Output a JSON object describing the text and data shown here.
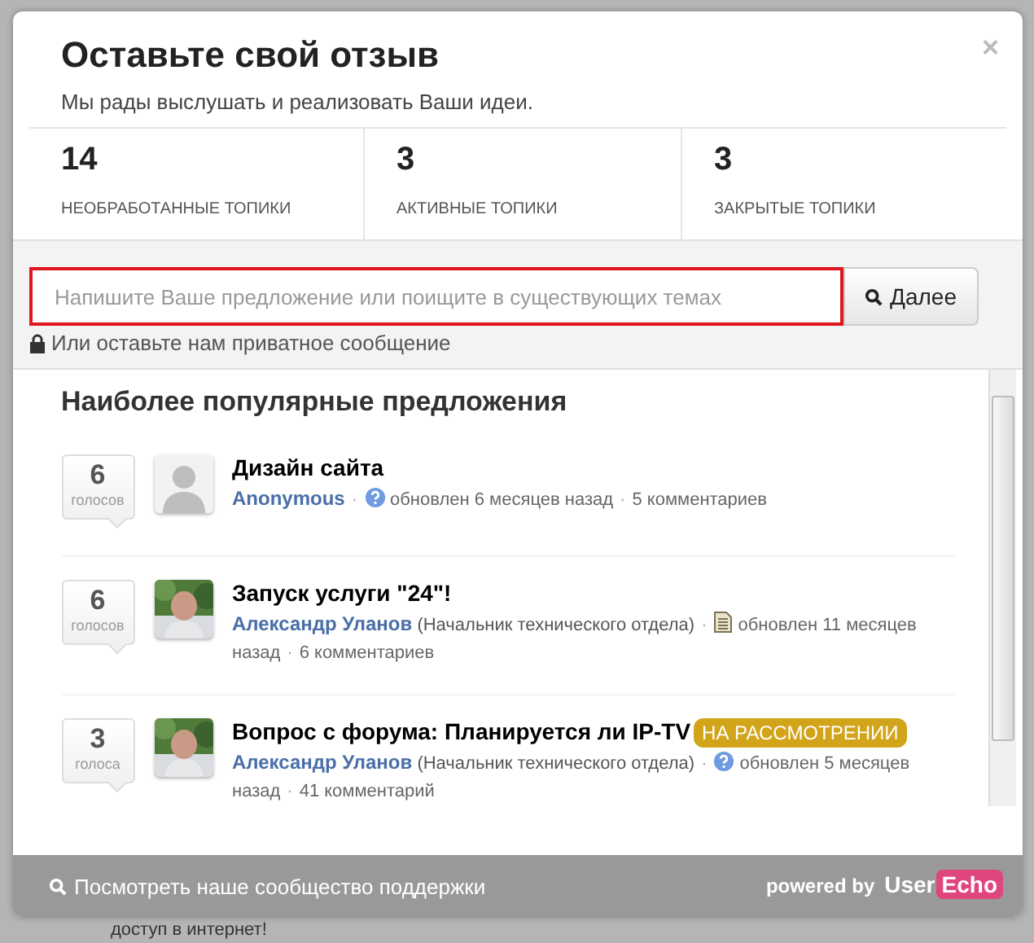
{
  "header": {
    "title": "Оставьте свой отзыв",
    "subtitle": "Мы рады выслушать и реализовать Ваши идеи.",
    "close": "×"
  },
  "stats": [
    {
      "count": "14",
      "label": "НЕОБРАБОТАННЫЕ ТОПИКИ"
    },
    {
      "count": "3",
      "label": "АКТИВНЫЕ ТОПИКИ"
    },
    {
      "count": "3",
      "label": "ЗАКРЫТЫЕ ТОПИКИ"
    }
  ],
  "search": {
    "placeholder": "Напишите Ваше предложение или поищите в существующих темах",
    "button": "Далее",
    "private_link": "Или оставьте нам приватное сообщение"
  },
  "list": {
    "heading": "Наиболее популярные предложения",
    "separator": "·",
    "topics": [
      {
        "votes": "6",
        "votes_label": "голосов",
        "avatar": {
          "kind": "anonymous"
        },
        "title": "Дизайн сайта",
        "author": "Anonymous",
        "status_icon": {
          "kind": "question"
        },
        "updated": "обновлен 6 месяцев назад",
        "comments": "5 комментариев"
      },
      {
        "votes": "6",
        "votes_label": "голосов",
        "title": "Запуск услуги \"24\"!",
        "author": "Александр Уланов",
        "role": "(Начальник технического отдела)",
        "status_icon": {
          "kind": "document"
        },
        "updated": "обновлен 11 месяцев назад",
        "comments": "6 комментариев"
      },
      {
        "votes": "3",
        "votes_label": "голоса",
        "title": "Вопрос с форума: Планируется ли IP-TV",
        "status": "НА РАССМОТРЕНИИ",
        "author": "Александр Уланов",
        "role": "(Начальник технического отдела)",
        "status_icon": {
          "kind": "question"
        },
        "updated": "обновлен 5 месяцев назад",
        "comments": "41 комментарий"
      }
    ]
  },
  "footer": {
    "community_link": "Посмотреть наше сообщество поддержки",
    "powered_by": "powered by",
    "brand_first": "User",
    "brand_second": "Echo"
  },
  "background": {
    "text": "доступ в интернет!"
  }
}
